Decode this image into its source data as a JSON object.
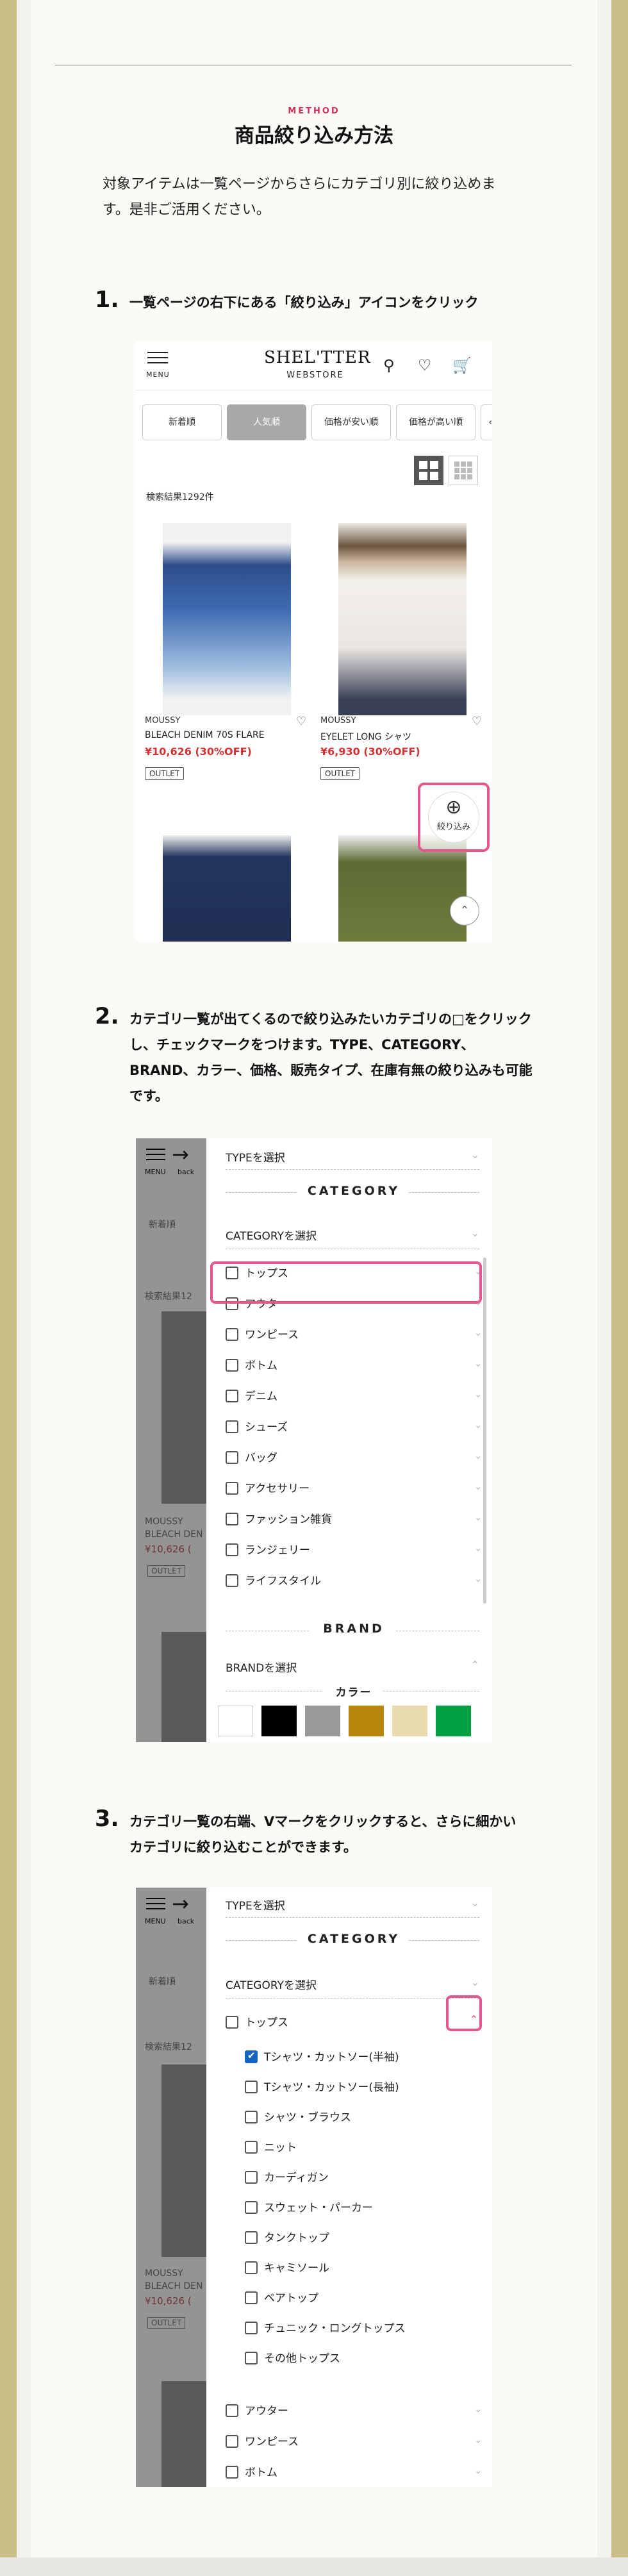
{
  "heading": {
    "method": "METHOD",
    "title": "商品絞り込み方法",
    "intro": "対象アイテムは一覧ページからさらにカテゴリ別に絞り込めます。是非ご活用ください。"
  },
  "steps": [
    {
      "num": "1.",
      "text": "一覧ページの右下にある「絞り込み」アイコンをクリック"
    },
    {
      "num": "2.",
      "text": "カテゴリ一覧が出てくるので絞り込みたいカテゴリの□をクリックし、チェックマークをつけます。TYPE、CATEGORY、BRAND、カラー、価格、販売タイプ、在庫有無の絞り込みも可能です。"
    },
    {
      "num": "3.",
      "text": "カテゴリ一覧の右端、Vマークをクリックすると、さらに細かいカテゴリに絞り込むことができます。"
    }
  ],
  "shot1": {
    "menu_label": "MENU",
    "logo": "SHEL'TTER",
    "logo_sub": "WEBSTORE",
    "tabs": [
      "新着順",
      "人気順",
      "価格が安い順",
      "価格が高い順"
    ],
    "active_tab": "人気順",
    "results": "検索結果1292件",
    "products": [
      {
        "brand": "MOUSSY",
        "name": "BLEACH DENIM 70S FLARE",
        "price": "¥10,626 (30%OFF)",
        "badge": "OUTLET"
      },
      {
        "brand": "MOUSSY",
        "name": "EYELET LONG シャツ",
        "price": "¥6,930 (30%OFF)",
        "badge": "OUTLET"
      }
    ],
    "filter_label": "絞り込み"
  },
  "drawer": {
    "menu_label": "MENU",
    "back_label": "back",
    "type_select": "TYPEを選択",
    "category_head": "CATEGORY",
    "category_select": "CATEGORYを選択",
    "brand_head": "BRAND",
    "brand_select": "BRANDを選択",
    "color_head": "カラー",
    "bg_tab": "新着順",
    "bg_results": "検索結果12",
    "bg_brand": "MOUSSY",
    "bg_name": "BLEACH DEN",
    "bg_price": "¥10,626 (",
    "bg_badge": "OUTLET"
  },
  "shot2": {
    "categories": [
      "トップス",
      "アウター",
      "ワンピース",
      "ボトム",
      "デニム",
      "シューズ",
      "バッグ",
      "アクセサリー",
      "ファッション雑貨",
      "ランジェリー",
      "ライフスタイル"
    ],
    "colors": [
      "#ffffff",
      "#000000",
      "#999999",
      "#b8860b",
      "#e8dcb0",
      "#00a040"
    ]
  },
  "shot3": {
    "parent": "トップス",
    "subcategories": [
      "Tシャツ・カットソー(半袖)",
      "Tシャツ・カットソー(長袖)",
      "シャツ・ブラウス",
      "ニット",
      "カーディガン",
      "スウェット・パーカー",
      "タンクトップ",
      "キャミソール",
      "ベアトップ",
      "チュニック・ロングトップス",
      "その他トップス"
    ],
    "checked": "Tシャツ・カットソー(半袖)",
    "after": [
      "アウター",
      "ワンピース",
      "ボトム"
    ]
  },
  "colors": {
    "accent": "#d0305a",
    "highlight": "#e5568d",
    "frame": "#cbbd87"
  }
}
